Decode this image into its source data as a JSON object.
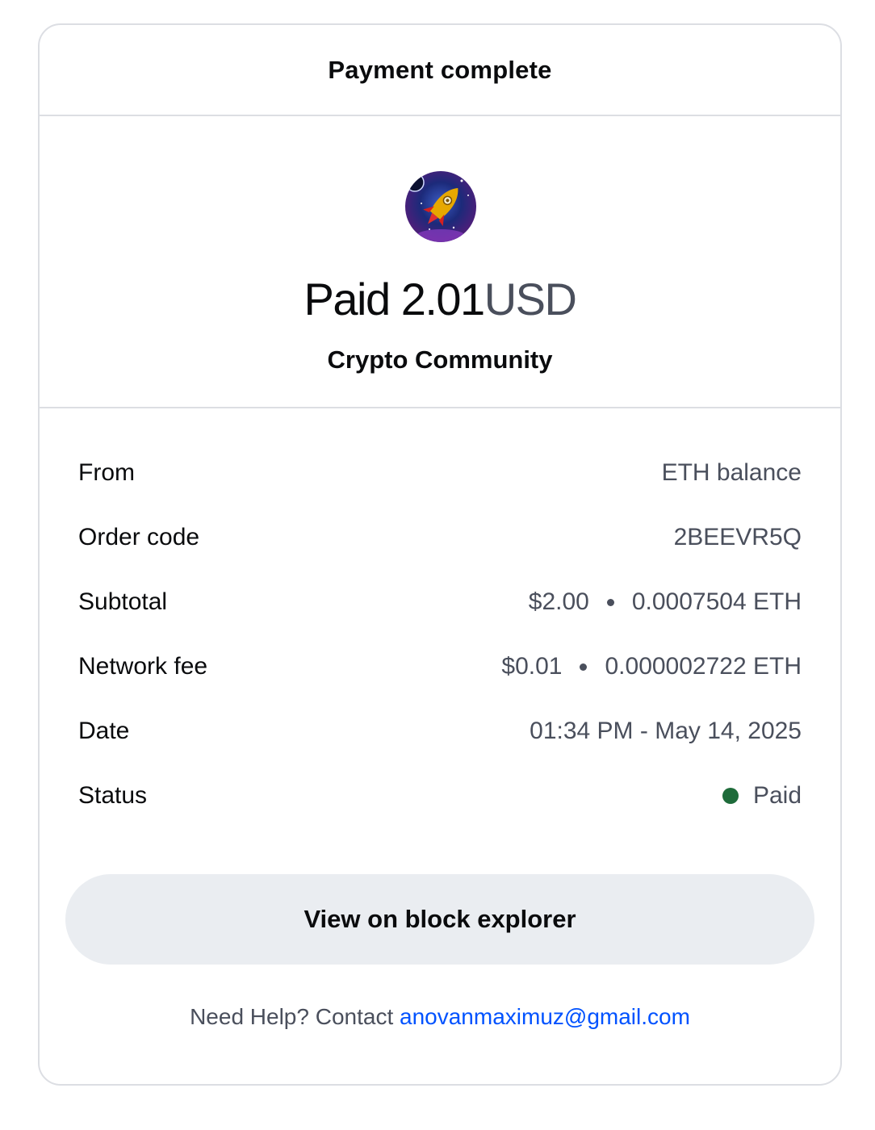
{
  "header": {
    "title": "Payment complete"
  },
  "summary": {
    "logo_icon": "rocket-icon",
    "paid_word": "Paid",
    "amount": "2.01",
    "currency": "USD",
    "merchant": "Crypto Community"
  },
  "details": [
    {
      "label": "From",
      "value": "ETH balance"
    },
    {
      "label": "Order code",
      "value": "2BEEVR5Q"
    },
    {
      "label": "Subtotal",
      "usd": "$2.00",
      "eth": "0.0007504 ETH"
    },
    {
      "label": "Network fee",
      "usd": "$0.01",
      "eth": "0.000002722 ETH"
    },
    {
      "label": "Date",
      "value": "01:34 PM - May 14, 2025"
    },
    {
      "label": "Status",
      "value": "Paid",
      "status_color": "#1e6b3a"
    }
  ],
  "actions": {
    "explorer_label": "View on block explorer"
  },
  "help": {
    "prefix": "Need Help? Contact",
    "email": "anovanmaximuz@gmail.com"
  },
  "colors": {
    "link": "#0052ff",
    "button_bg": "#eaedf1",
    "muted_text": "#4a4f5c"
  }
}
